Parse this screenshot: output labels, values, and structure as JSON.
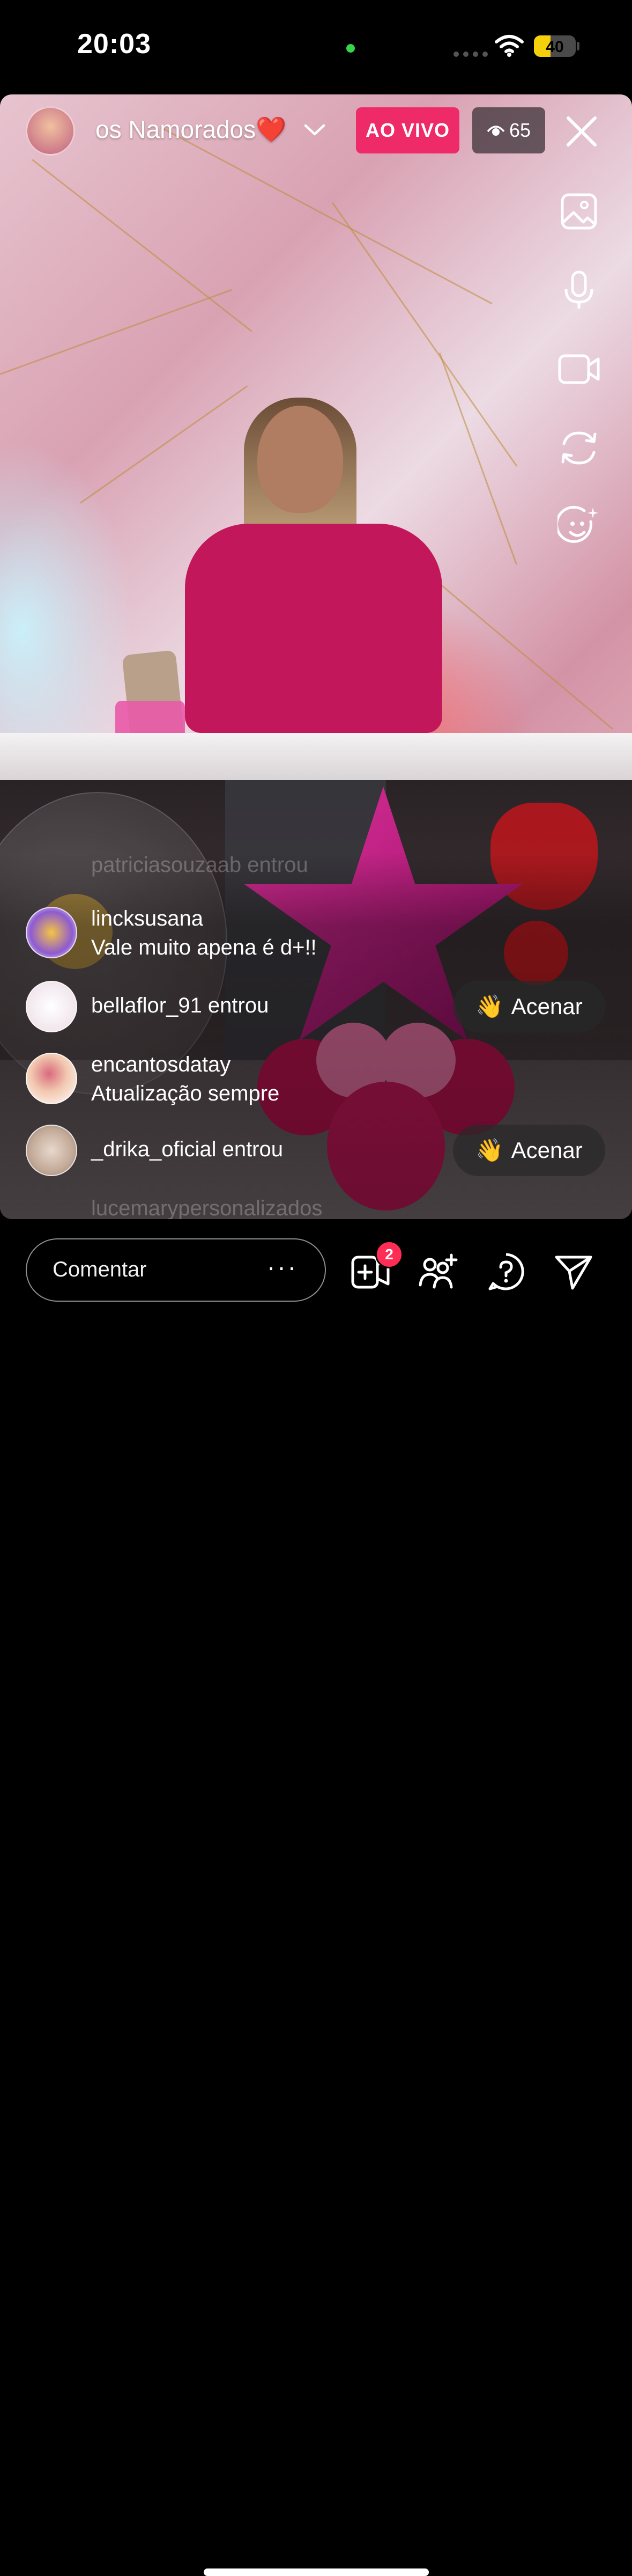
{
  "status_bar": {
    "time": "20:03",
    "battery_level": "40",
    "battery_fraction": 0.4,
    "battery_color": "#f5d10c"
  },
  "live_header": {
    "title": "os Namorados",
    "title_emoji": "❤️",
    "live_badge": "AO VIVO",
    "live_badge_color": "#ee2a68",
    "viewer_count": "65",
    "icons": [
      "avatar",
      "chevron-down-icon",
      "eye-icon",
      "close-icon"
    ]
  },
  "side_tools": [
    "image-icon",
    "microphone-icon",
    "video-camera-icon",
    "flip-camera-icon",
    "effects-smiley-icon"
  ],
  "comments": {
    "ghost_top": "patriciasouzaab entrou",
    "ghost_bottom": "lucemarypersonalizados",
    "items": [
      {
        "user": "lincksusana",
        "message": "Vale muito apena é d+!!"
      },
      {
        "user": "bellaflor_91 entrou",
        "message": "",
        "action": "Acenar",
        "action_emoji": "👋"
      },
      {
        "user": "encantosdatay",
        "message": "Atualização sempre"
      },
      {
        "user": "_drika_oficial entrou",
        "message": "",
        "action": "Acenar",
        "action_emoji": "👋"
      }
    ]
  },
  "bottom_bar": {
    "comment_placeholder": "Comentar",
    "more_label": "···",
    "add_guest_badge": "2",
    "icons": [
      "add-guest-icon",
      "request-to-join-icon",
      "question-icon",
      "send-icon"
    ]
  }
}
